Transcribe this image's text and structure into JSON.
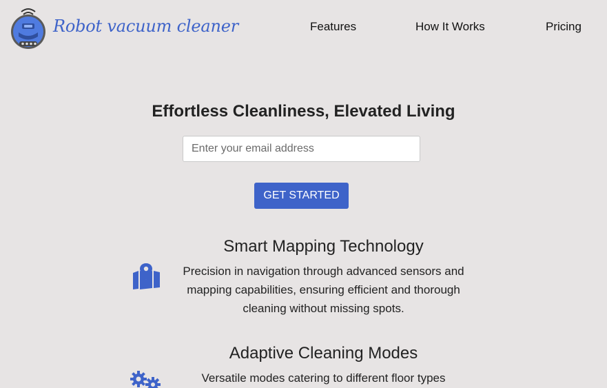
{
  "header": {
    "brand": "Robot vacuum cleaner",
    "logo_icon": "robot-vacuum-icon",
    "nav": [
      "Features",
      "How It Works",
      "Pricing"
    ]
  },
  "hero": {
    "title": "Effortless Cleanliness, Elevated Living",
    "email_placeholder": "Enter your email address",
    "cta_label": "GET STARTED"
  },
  "features": [
    {
      "icon": "map-location-icon",
      "title": "Smart Mapping Technology",
      "description": "Precision in navigation through advanced sensors and mapping capabilities, ensuring efficient and thorough cleaning without missing spots."
    },
    {
      "icon": "gears-icon",
      "title": "Adaptive Cleaning Modes",
      "description": "Versatile modes catering to different floor types"
    }
  ],
  "colors": {
    "background": "#e7e4e4",
    "accent": "#3e63c9",
    "text": "#222222"
  }
}
